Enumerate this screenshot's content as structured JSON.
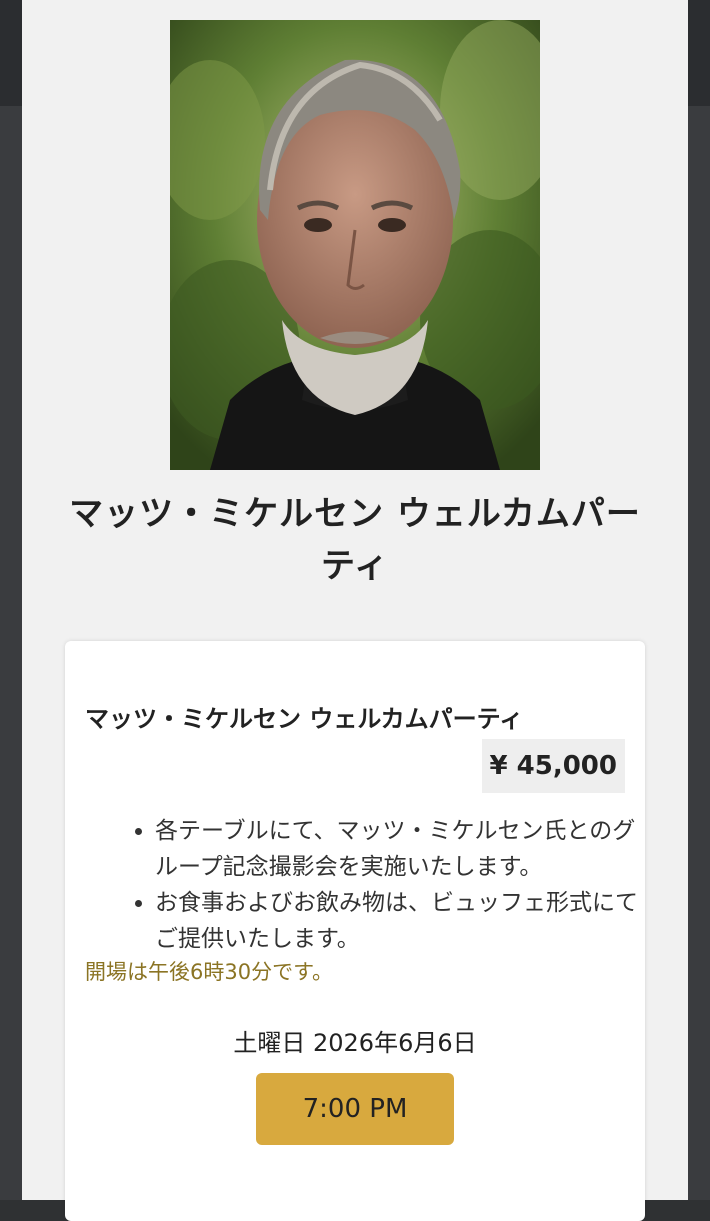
{
  "event": {
    "title_line1": "マッツ・ミケルセン ウェルカムパー",
    "title_line2": "ティ"
  },
  "ticket": {
    "name": "マッツ・ミケルセン ウェルカムパーティ",
    "price": "¥ 45,000",
    "features": [
      "各テーブルにて、マッツ・ミケルセン氏とのグループ記念撮影会を実施いたします。",
      "お食事およびお飲み物は、ビュッフェ形式にてご提供いたします。"
    ],
    "doors_note": "開場は午後6時30分です。",
    "date": "土曜日 2026年6月6日",
    "time_slot": "7:00 PM"
  },
  "colors": {
    "page_background": "#f1f1f1",
    "card_background": "#ffffff",
    "accent_gold": "#d8a93e",
    "note_text": "#8b7424"
  }
}
